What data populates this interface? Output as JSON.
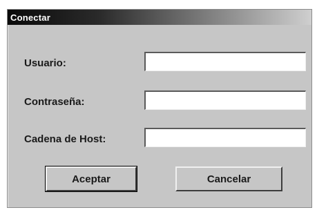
{
  "dialog": {
    "title": "Conectar",
    "fields": [
      {
        "label": "Usuario:",
        "value": ""
      },
      {
        "label": "Contraseña:",
        "value": ""
      },
      {
        "label": "Cadena de Host:",
        "value": ""
      }
    ],
    "buttons": {
      "accept": "Aceptar",
      "cancel": "Cancelar"
    }
  }
}
